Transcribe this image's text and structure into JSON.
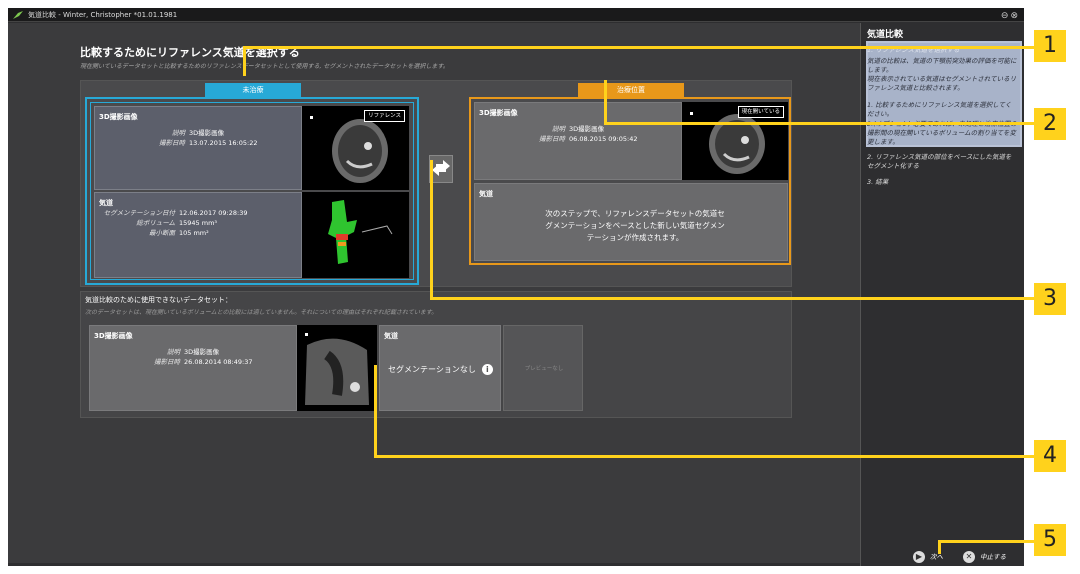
{
  "window": {
    "title": "気道比較 - Winter, Christopher *01.01.1981"
  },
  "main": {
    "heading": "比較するためにリファレンス気道を選択する",
    "subheading": "現在開いているデータセットと比較するためのリファレンスデータセットとして使用する, セグメントされたデータセットを選択します。"
  },
  "untreated": {
    "tag": "未治療",
    "image_card": {
      "header": "3D撮影画像",
      "desc_label": "説明",
      "desc_value": "3D撮影画像",
      "date_label": "撮影日時",
      "date_value": "13.07.2015 16:05:22",
      "badge": "リファレンス"
    },
    "airway_card": {
      "header": "気道",
      "rows": [
        {
          "label": "セグメンテーション日付",
          "value": "12.06.2017 09:28:39"
        },
        {
          "label": "総ボリューム",
          "value": "15945 mm³"
        },
        {
          "label": "最小断面",
          "value": "105 mm²"
        }
      ]
    }
  },
  "treatment": {
    "tag": "治療位置",
    "image_card": {
      "header": "3D撮影画像",
      "desc_label": "説明",
      "desc_value": "3D撮影画像",
      "date_label": "撮影日時",
      "date_value": "06.08.2015 09:05:42",
      "badge": "現在開いている"
    },
    "airway_card": {
      "header": "気道",
      "message": "次のステップで、リファレンスデータセットの気道セグメンテーションをベースとした新しい気道セグメンテーションが作成されます。"
    }
  },
  "unusable": {
    "title": "気道比較のために使用できないデータセット：",
    "subtitle": "次のデータセットは、現在開いているボリュームとの比較には適していません。それについての理由はそれぞれ記載されています。",
    "image_card": {
      "header": "3D撮影画像",
      "desc_label": "説明",
      "desc_value": "3D撮影画像",
      "date_label": "撮影日時",
      "date_value": "26.08.2014 08:49:37"
    },
    "airway_card": {
      "header": "気道",
      "status": "セグメンテーションなし"
    },
    "preview_text": "プレビューなし"
  },
  "right_panel": {
    "title": "気道比較",
    "steps": [
      "1. リファレンス気道を選択する",
      "気道の比較は、気道の下顎前突効果の評価を可能にします。",
      "現在表示されている気道はセグメントされているリファレンス気道と比較されます。",
      "1. 比較するためにリファレンス気道を選択してください。",
      "2.(オプション) 必要であれば、未処理と治療位置の撮影間の現在開いているボリュームの割り当てを変更します。",
      "2. リファレンス気道の部位をベースにした気道をセグメント化する",
      "3. 結果"
    ]
  },
  "buttons": {
    "next": "次へ",
    "cancel": "中止する"
  },
  "callouts": [
    "1",
    "2",
    "3",
    "4",
    "5"
  ],
  "colors": {
    "untreated_accent": "#27a9d7",
    "treatment_accent": "#e8981a",
    "callout": "#ffd21c"
  }
}
